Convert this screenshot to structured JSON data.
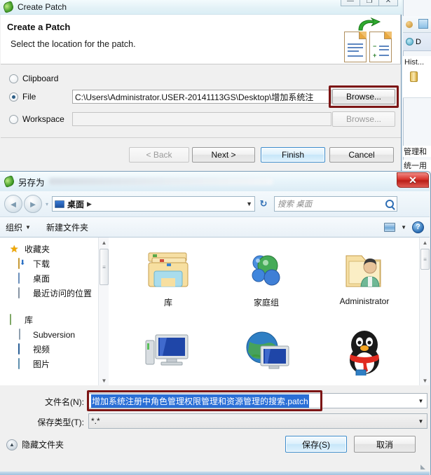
{
  "ide_background": {
    "palette_icon": "coffee-bean-icon",
    "debug_tab_label": "D",
    "history_label": "Hist...",
    "cn_line_1": "管理和",
    "cn_line_2": "统一用"
  },
  "wizard": {
    "title": "Create Patch",
    "window_buttons": {
      "minimize": "—",
      "maximize": "❐",
      "close": "✕"
    },
    "header": {
      "title": "Create a Patch",
      "subtitle": "Select the location for the patch."
    },
    "options": [
      {
        "id": "clipboard",
        "label_before": "C",
        "label_mnemonic": "l",
        "label_after": "ipboard",
        "label": "Clipboard",
        "selected": false
      },
      {
        "id": "file",
        "label_before": "Fil",
        "label_mnemonic": "e",
        "label_after": "",
        "label": "File",
        "selected": true
      },
      {
        "id": "workspace",
        "label_before": "",
        "label_mnemonic": "W",
        "label_after": "orkspace",
        "label": "Workspace",
        "selected": false
      }
    ],
    "file_path_value": "C:\\Users\\Administrator.USER-20141113GS\\Desktop\\增加系统注",
    "workspace_path_value": "",
    "browse_file_label": "Browse...",
    "browse_workspace_label": "Browse...",
    "buttons": {
      "back": "< Back",
      "next": "Next >",
      "finish": "Finish",
      "cancel": "Cancel"
    },
    "highlight_color": "#7c1515"
  },
  "saveas": {
    "title": "另存为",
    "close_label": "✕",
    "nav": {
      "back_icon": "back-arrow-icon",
      "forward_icon": "forward-arrow-icon",
      "history_caret": "▾",
      "address_icon": "desktop-icon",
      "address_value": "桌面",
      "address_separator": "▶",
      "address_caret": "▼",
      "refresh_icon": "refresh-icon",
      "search_placeholder": "搜索 桌面",
      "search_icon": "search-icon"
    },
    "toolbar": {
      "organize_label": "组织",
      "organize_caret": "▼",
      "new_folder_label": "新建文件夹",
      "view_icon": "view-mode-icon",
      "view_caret": "▼",
      "help_icon": "help-icon"
    },
    "places": [
      {
        "label": "收藏夹",
        "icon": "star-icon",
        "level": 1
      },
      {
        "label": "下载",
        "icon": "downloads-folder-icon",
        "level": 2
      },
      {
        "label": "桌面",
        "icon": "desktop-icon",
        "level": 2
      },
      {
        "label": "最近访问的位置",
        "icon": "recent-places-icon",
        "level": 2
      },
      {
        "label": "",
        "icon": "spacer",
        "level": 2
      },
      {
        "label": "库",
        "icon": "library-icon",
        "level": 1
      },
      {
        "label": "Subversion",
        "icon": "subversion-folder-icon",
        "level": 2
      },
      {
        "label": "视频",
        "icon": "video-folder-icon",
        "level": 2
      },
      {
        "label": "图片",
        "icon": "pictures-folder-icon",
        "level": 2
      }
    ],
    "files": [
      {
        "label": "库",
        "icon": "library-folder-icon"
      },
      {
        "label": "家庭组",
        "icon": "homegroup-icon"
      },
      {
        "label": "Administrator",
        "icon": "user-folder-icon"
      },
      {
        "label": "",
        "icon": "computer-icon"
      },
      {
        "label": "",
        "icon": "network-icon"
      },
      {
        "label": "",
        "icon": "qq-penguin-icon"
      }
    ],
    "filename": {
      "label": "文件名(N):",
      "value": "增加系统注册中角色管理权限管理和资源管理的搜索.patch",
      "caret": "▼",
      "selected": true
    },
    "filetype": {
      "label": "保存类型(T):",
      "value": "*.*",
      "caret": "▼"
    },
    "hide_folders_label": "隐藏文件夹",
    "hide_folders_caret": "▲",
    "buttons": {
      "save": "保存(S)",
      "cancel": "取消"
    },
    "highlight_color": "#7c1515"
  }
}
